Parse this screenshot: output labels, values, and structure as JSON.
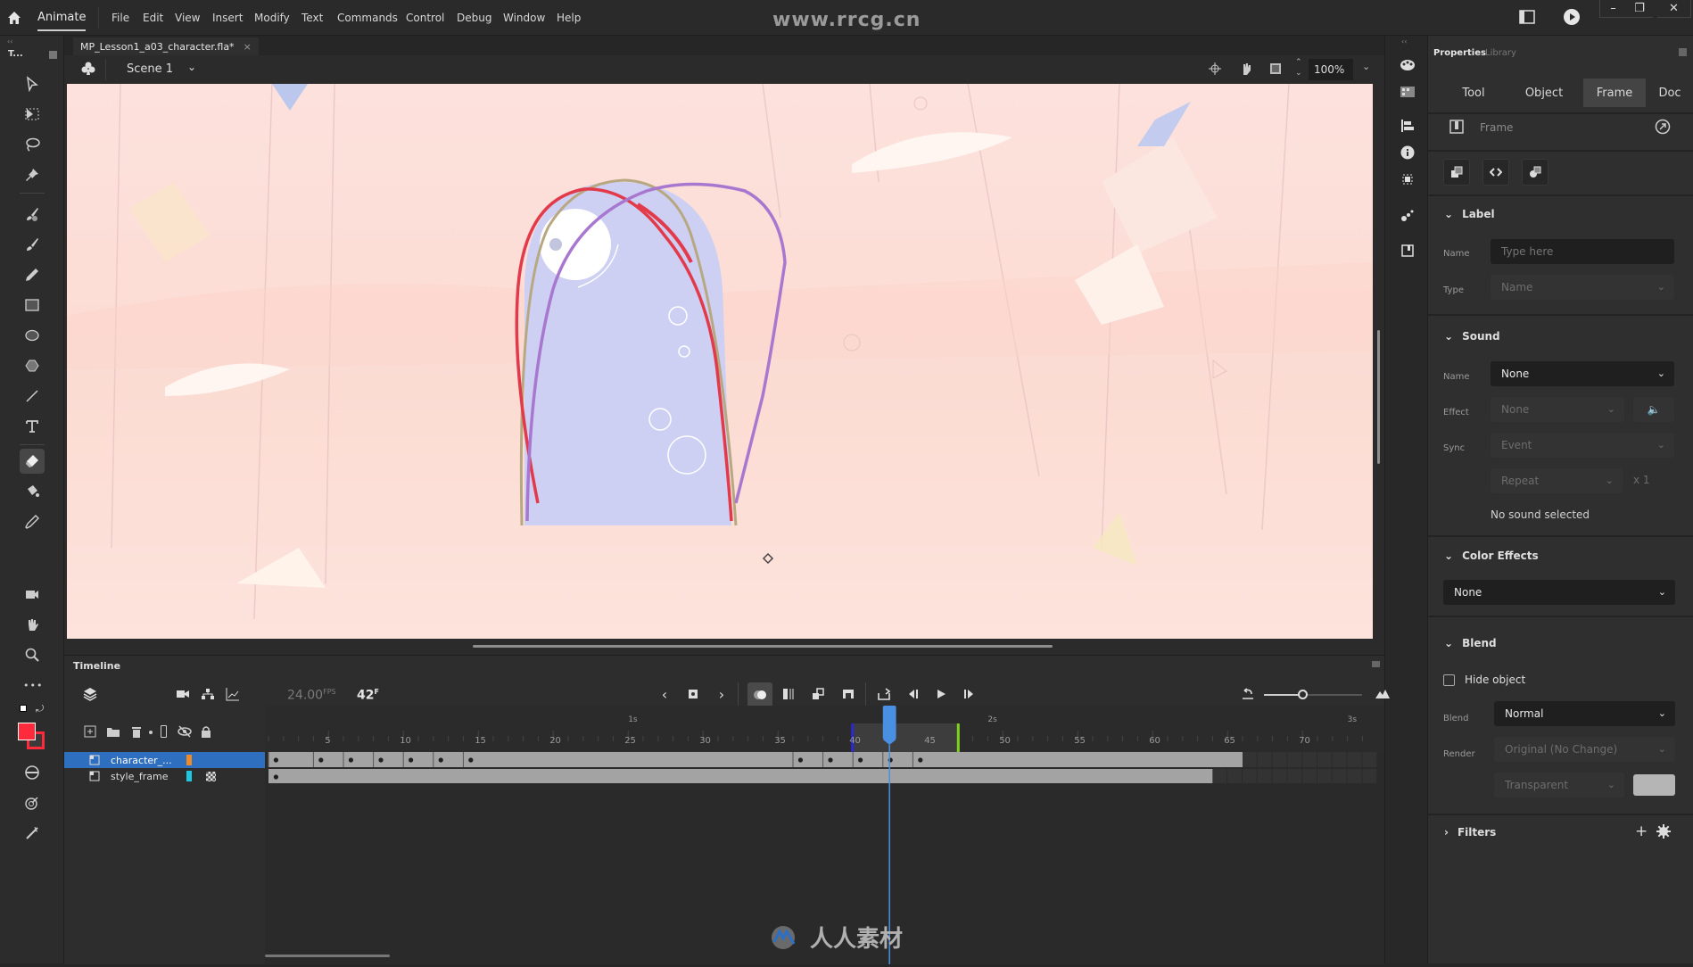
{
  "app": {
    "name": "Animate",
    "menus": [
      "File",
      "Edit",
      "View",
      "Insert",
      "Modify",
      "Text",
      "Commands",
      "Control",
      "Debug",
      "Window",
      "Help"
    ],
    "watermark": "www.rrcg.cn",
    "window_controls": {
      "minimize": "–",
      "restore": "❐",
      "close": "✕"
    }
  },
  "document": {
    "tab_title": "MP_Lesson1_a03_character.fla*",
    "tab_close": "×",
    "scene": "Scene 1",
    "zoom": "100%"
  },
  "toolbar": {
    "collapse": "‹‹",
    "workspace_label": "T...",
    "tools": [
      "selection",
      "subselection",
      "lasso",
      "pin",
      "paint-brush",
      "brush",
      "pencil",
      "rectangle",
      "oval",
      "polystar",
      "line",
      "text",
      "eraser",
      "paint-bucket",
      "eyedropper",
      "camera",
      "hand",
      "zoom"
    ],
    "active_tool": "eraser",
    "more": "•••",
    "stroke_color": "#ff2a3c",
    "fill_color": "#ff2a3c"
  },
  "properties": {
    "tabs_header": [
      "Properties",
      "Library"
    ],
    "tabs": [
      "Tool",
      "Object",
      "Frame",
      "Doc"
    ],
    "active_tab": "Frame",
    "frame_label": "Frame",
    "label_section": {
      "title": "Label",
      "name_label": "Name",
      "name_placeholder": "Type here",
      "type_label": "Type",
      "type_value": "Name"
    },
    "sound_section": {
      "title": "Sound",
      "name_label": "Name",
      "name_value": "None",
      "effect_label": "Effect",
      "effect_value": "None",
      "sync_label": "Sync",
      "sync_value": "Event",
      "repeat_value": "Repeat",
      "repeat_count": "x 1",
      "status": "No sound selected"
    },
    "color_effects": {
      "title": "Color Effects",
      "value": "None"
    },
    "blend_section": {
      "title": "Blend",
      "hide_object": "Hide object",
      "hide_object_checked": false,
      "blend_label": "Blend",
      "blend_value": "Normal",
      "render_label": "Render",
      "render_value": "Original (No Change)",
      "transparent_value": "Transparent",
      "swatch_color": "#b5b5b5"
    },
    "filters": {
      "title": "Filters"
    }
  },
  "timeline": {
    "title": "Timeline",
    "fps": "24.00",
    "fps_unit": "FPS",
    "current_frame": "42",
    "frame_unit": "F",
    "ruler_numbers": [
      "5",
      "10",
      "15",
      "20",
      "25",
      "30",
      "35",
      "40",
      "45",
      "50",
      "55",
      "60",
      "65",
      "70"
    ],
    "seconds_marks": [
      "1s",
      "2s",
      "3s"
    ],
    "layers": [
      {
        "name": "character_...",
        "color": "#f08a24",
        "selected": true
      },
      {
        "name": "style_frame",
        "color": "#1ec8e0",
        "selected": false
      }
    ],
    "character_keyframes": [
      1,
      4,
      6,
      8,
      10,
      12,
      14,
      36,
      38,
      40,
      42,
      44
    ],
    "character_end_frame": 66,
    "style_end_frame": 64,
    "playhead_frame": 42,
    "onion_start": 40,
    "onion_end": 47
  },
  "bottom_watermark": "人人素材"
}
